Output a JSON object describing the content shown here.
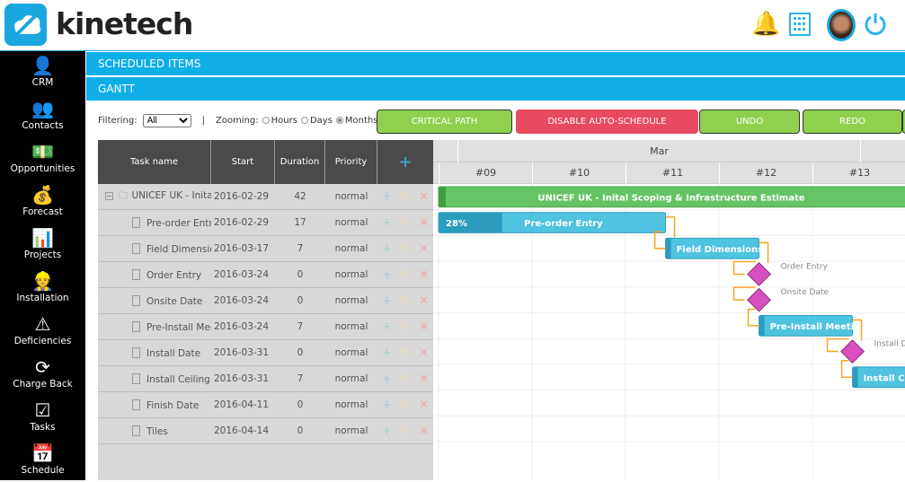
{
  "brand": {
    "name": "kinetech",
    "accent": "#0faee6"
  },
  "header_icons": [
    "bell-icon",
    "building-icon",
    "avatar",
    "power-icon"
  ],
  "sidebar": {
    "items": [
      {
        "label": "CRM",
        "icon": "👤"
      },
      {
        "label": "Contacts",
        "icon": "👥"
      },
      {
        "label": "Opportunities",
        "icon": "💵"
      },
      {
        "label": "Forecast",
        "icon": "💰"
      },
      {
        "label": "Projects",
        "icon": "📊"
      },
      {
        "label": "Installation",
        "icon": "👷"
      },
      {
        "label": "Deficiencies",
        "icon": "⚠"
      },
      {
        "label": "Charge Back",
        "icon": "⟳"
      },
      {
        "label": "Tasks",
        "icon": "☑"
      },
      {
        "label": "Schedule",
        "icon": "📅"
      }
    ]
  },
  "sections": {
    "scheduled": "SCHEDULED ITEMS",
    "gantt": "GANTT"
  },
  "toolbar": {
    "filter_label": "Filtering:",
    "filter_value": "All",
    "sep": "|",
    "zoom_label": "Zooming:",
    "zoom_options": [
      "Hours",
      "Days",
      "Months"
    ],
    "zoom_selected": "Months",
    "buttons": [
      {
        "label": "CRITICAL PATH",
        "color": "#8fd14f"
      },
      {
        "label": "DISABLE AUTO-SCHEDULE",
        "color": "#e84a5f"
      },
      {
        "label": "UNDO",
        "color": "#8fd14f"
      },
      {
        "label": "REDO",
        "color": "#8fd14f"
      }
    ]
  },
  "grid": {
    "columns": [
      "Task name",
      "Start",
      "Duration",
      "Priority",
      "+"
    ],
    "rows": [
      {
        "name": "UNICEF UK - Inital Scoping & Infrastructure Estimate",
        "start": "2016-02-29",
        "duration": "42",
        "priority": "normal",
        "type": "project"
      },
      {
        "name": "Pre-order Entry",
        "start": "2016-02-29",
        "duration": "17",
        "priority": "normal",
        "type": "task",
        "progress": "28%"
      },
      {
        "name": "Field Dimensions",
        "start": "2016-03-17",
        "duration": "7",
        "priority": "normal",
        "type": "task"
      },
      {
        "name": "Order Entry",
        "start": "2016-03-24",
        "duration": "0",
        "priority": "normal",
        "type": "milestone"
      },
      {
        "name": "Onsite Date",
        "start": "2016-03-24",
        "duration": "0",
        "priority": "normal",
        "type": "milestone"
      },
      {
        "name": "Pre-Install Meeting",
        "start": "2016-03-24",
        "duration": "7",
        "priority": "normal",
        "type": "task"
      },
      {
        "name": "Install Date",
        "start": "2016-03-31",
        "duration": "0",
        "priority": "normal",
        "type": "milestone"
      },
      {
        "name": "Install Ceiling Tiles",
        "start": "2016-03-31",
        "duration": "7",
        "priority": "normal",
        "type": "task"
      },
      {
        "name": "Finish Date",
        "start": "2016-04-11",
        "duration": "0",
        "priority": "normal",
        "type": "milestone"
      },
      {
        "name": "Tiles",
        "start": "2016-04-14",
        "duration": "0",
        "priority": "normal",
        "type": "milestone"
      }
    ]
  },
  "timeline": {
    "month": "Mar",
    "weeks": [
      "#09",
      "#10",
      "#11",
      "#12",
      "#13"
    ]
  },
  "colors": {
    "project": "#65c466",
    "task": "#4fc3e0",
    "task_progress": "#2b9cbf",
    "milestone": "#d94fbf",
    "link": "#f5a623"
  }
}
